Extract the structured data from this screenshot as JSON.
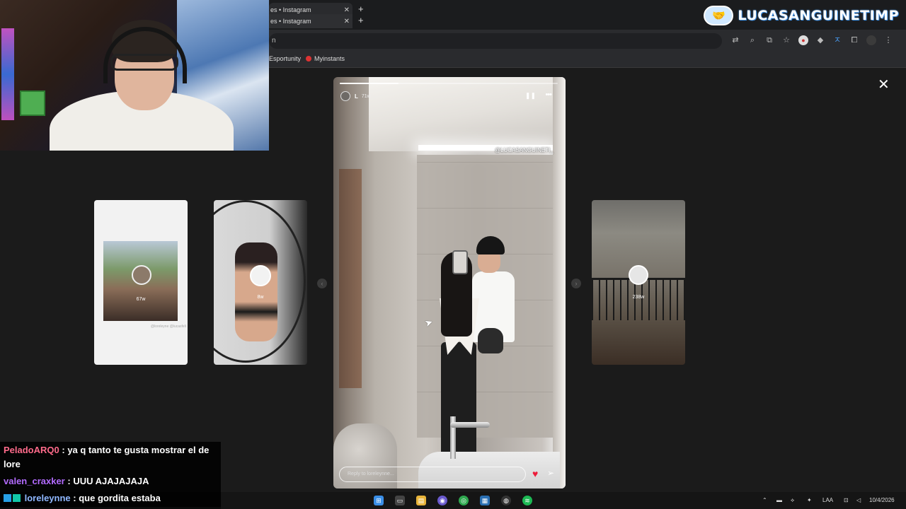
{
  "brand": {
    "text": "LUCASANGUINETIMP",
    "logo_icon": "handshake"
  },
  "browser": {
    "tabs": [
      {
        "label": "es • Instagram"
      },
      {
        "label": "es • Instagram"
      }
    ],
    "new_tab_glyph": "+",
    "omnibox_text": "n",
    "bookmarks": [
      {
        "label": "Esportunity"
      },
      {
        "label": "Myinstants"
      }
    ]
  },
  "viewer": {
    "close_glyph": "✕",
    "previews": [
      {
        "time": "67w",
        "caption": "@loreleyne @lucasfeli"
      },
      {
        "time": "8w"
      },
      {
        "time": "238w"
      }
    ],
    "story": {
      "user": "L",
      "time": "71w",
      "progress": 0.27,
      "watermark": "@LUCASANGUINETI_",
      "reply_placeholder": "Reply to loreleynne..."
    }
  },
  "chat": [
    {
      "user": "PeladoARQ0",
      "color": "#ff6b8b",
      "message": "ya q tanto te gusta mostrar el de lore"
    },
    {
      "user": "valen_craxker",
      "color": "#b36bff",
      "message": "UUU AJAJAJAJA"
    },
    {
      "user": "loreleynne",
      "color": "#8fb7ff",
      "message": "que gordita estaba"
    }
  ],
  "taskbar": {
    "lang": "LAA",
    "date": "10/4/2026"
  },
  "colors": {
    "accent": "#ed1c3a",
    "brand_blue": "#3b86d6"
  }
}
